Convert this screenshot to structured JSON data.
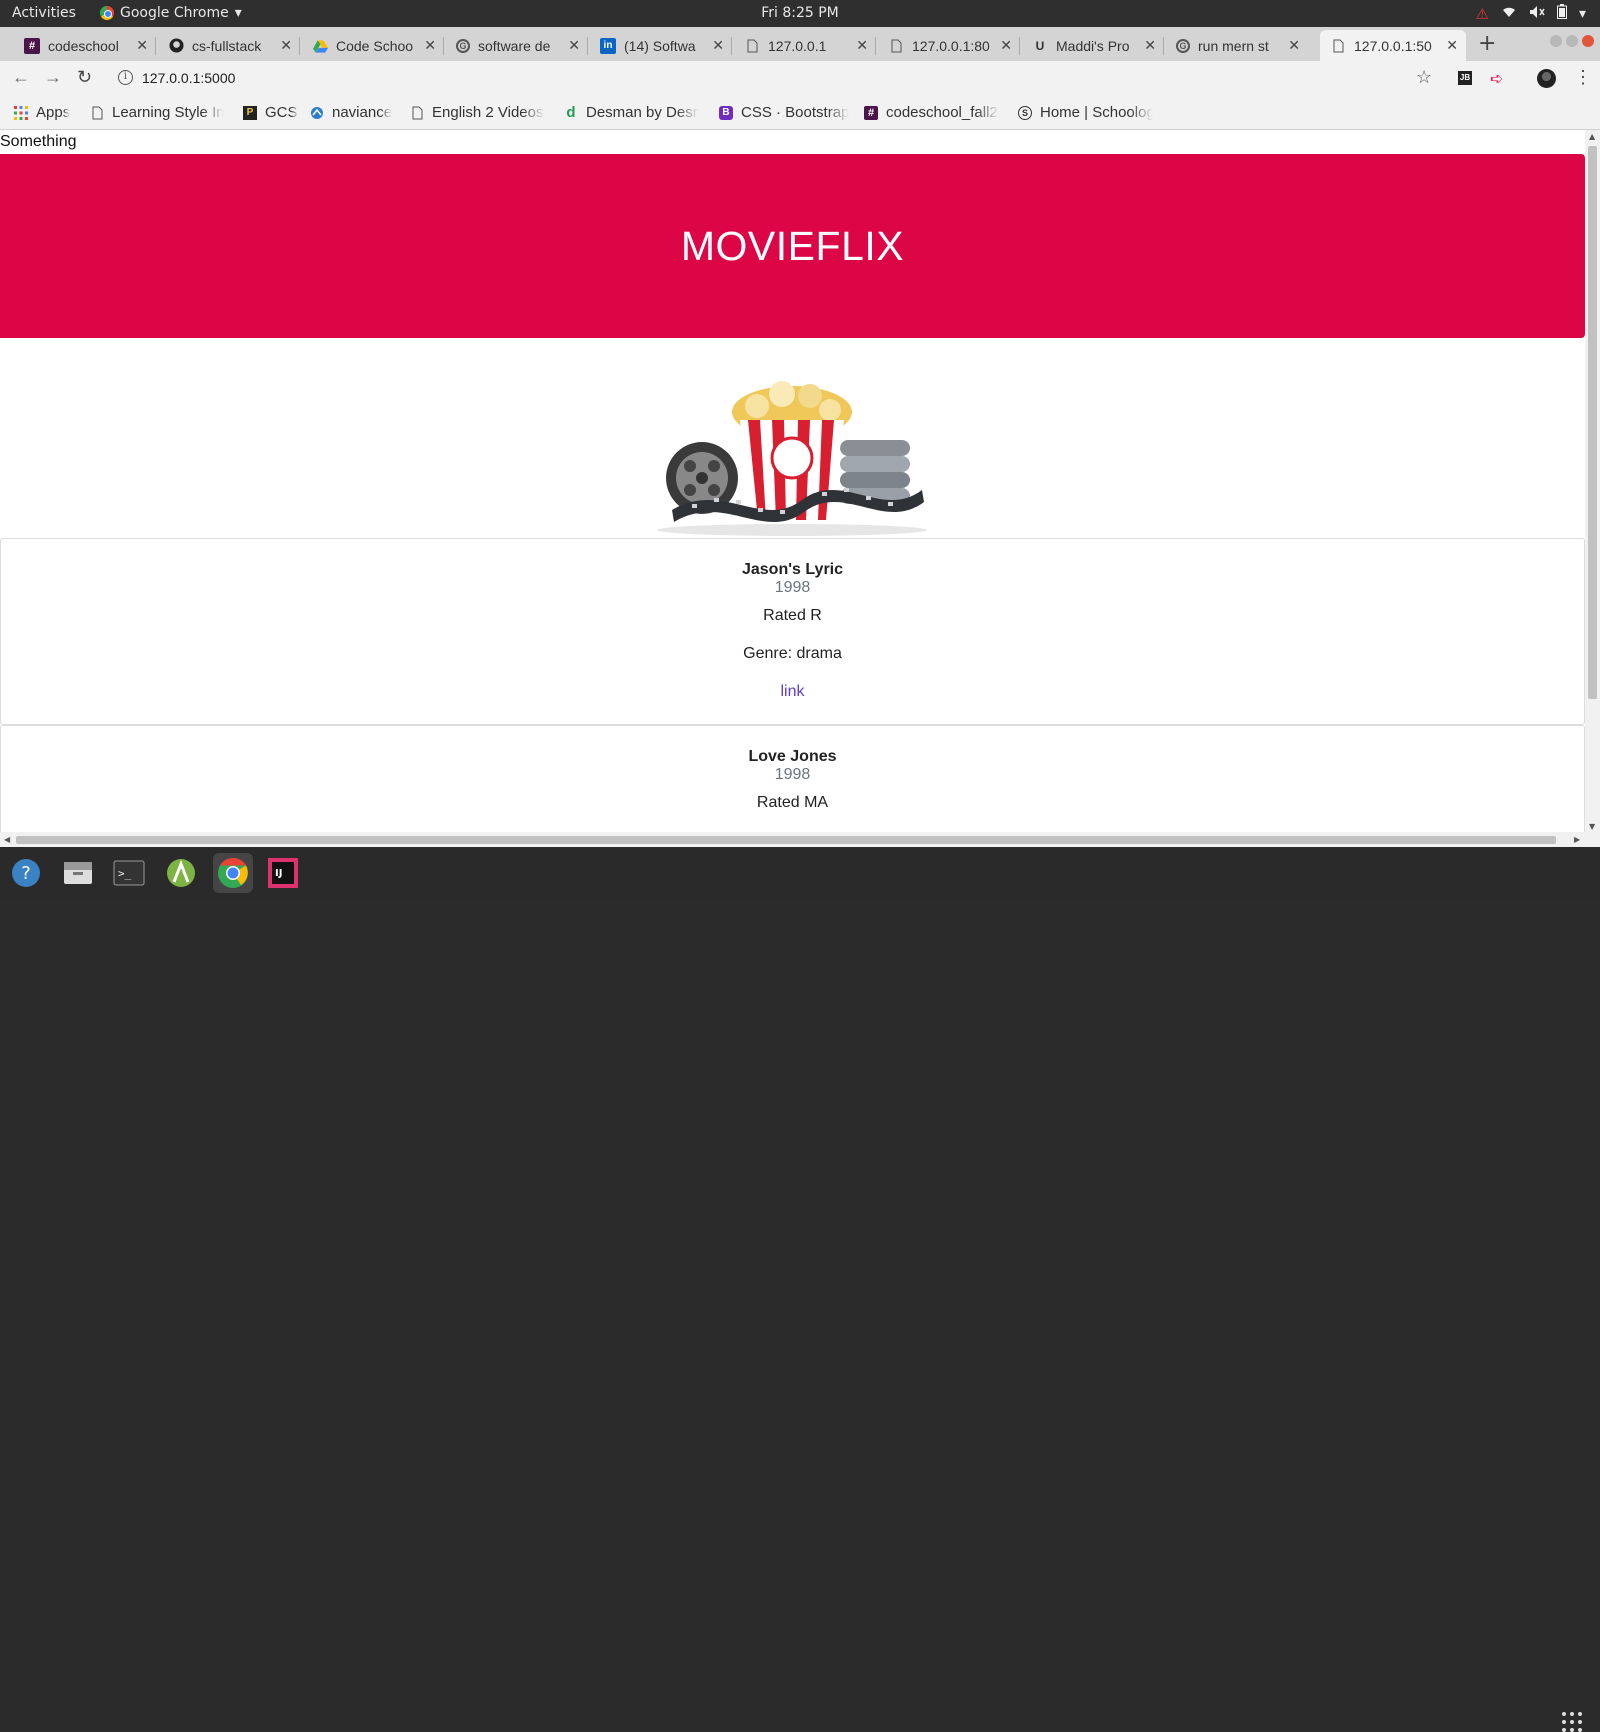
{
  "topbar": {
    "activities": "Activities",
    "app_name": "Google Chrome",
    "clock": "Fri  8:25 PM"
  },
  "tabs": [
    {
      "title": "codeschool",
      "icon": "hash-icon"
    },
    {
      "title": "cs-fullstack",
      "icon": "github-icon"
    },
    {
      "title": "Code Schoo",
      "icon": "drive-icon"
    },
    {
      "title": "software de",
      "icon": "google-icon"
    },
    {
      "title": "(14) Softwa",
      "icon": "linkedin-icon"
    },
    {
      "title": "127.0.0.1",
      "icon": "page-icon"
    },
    {
      "title": "127.0.0.1:80",
      "icon": "page-icon"
    },
    {
      "title": "Maddi's Pro",
      "icon": "u-icon"
    },
    {
      "title": "run mern st",
      "icon": "google-icon"
    },
    {
      "title": "127.0.0.1:50",
      "icon": "page-icon",
      "active": true
    }
  ],
  "address": {
    "url": "127.0.0.1:5000"
  },
  "bookmarks": [
    {
      "label": "Apps",
      "icon": "apps-grid-icon"
    },
    {
      "label": "Learning Style In",
      "icon": "page-icon"
    },
    {
      "label": "GCS",
      "icon": "gcs-icon"
    },
    {
      "label": "naviance",
      "icon": "naviance-icon"
    },
    {
      "label": "English 2 Videos",
      "icon": "page-icon"
    },
    {
      "label": "Desman by Desm",
      "icon": "desman-icon"
    },
    {
      "label": "CSS · Bootstrap",
      "icon": "bootstrap-icon"
    },
    {
      "label": "codeschool_fall2",
      "icon": "hash-icon"
    },
    {
      "label": "Home | Schoolog",
      "icon": "schoology-icon"
    }
  ],
  "page": {
    "top_text": "Something",
    "banner_title": "MOVIEFLIX",
    "movies": [
      {
        "title": "Jason's Lyric",
        "year": "1998",
        "rating": "Rated R",
        "genre": "Genre: drama",
        "link": "link"
      },
      {
        "title": "Love Jones",
        "year": "1998",
        "rating": "Rated MA"
      }
    ]
  },
  "colors": {
    "banner": "#dc0545",
    "link": "#5b3bd6"
  }
}
